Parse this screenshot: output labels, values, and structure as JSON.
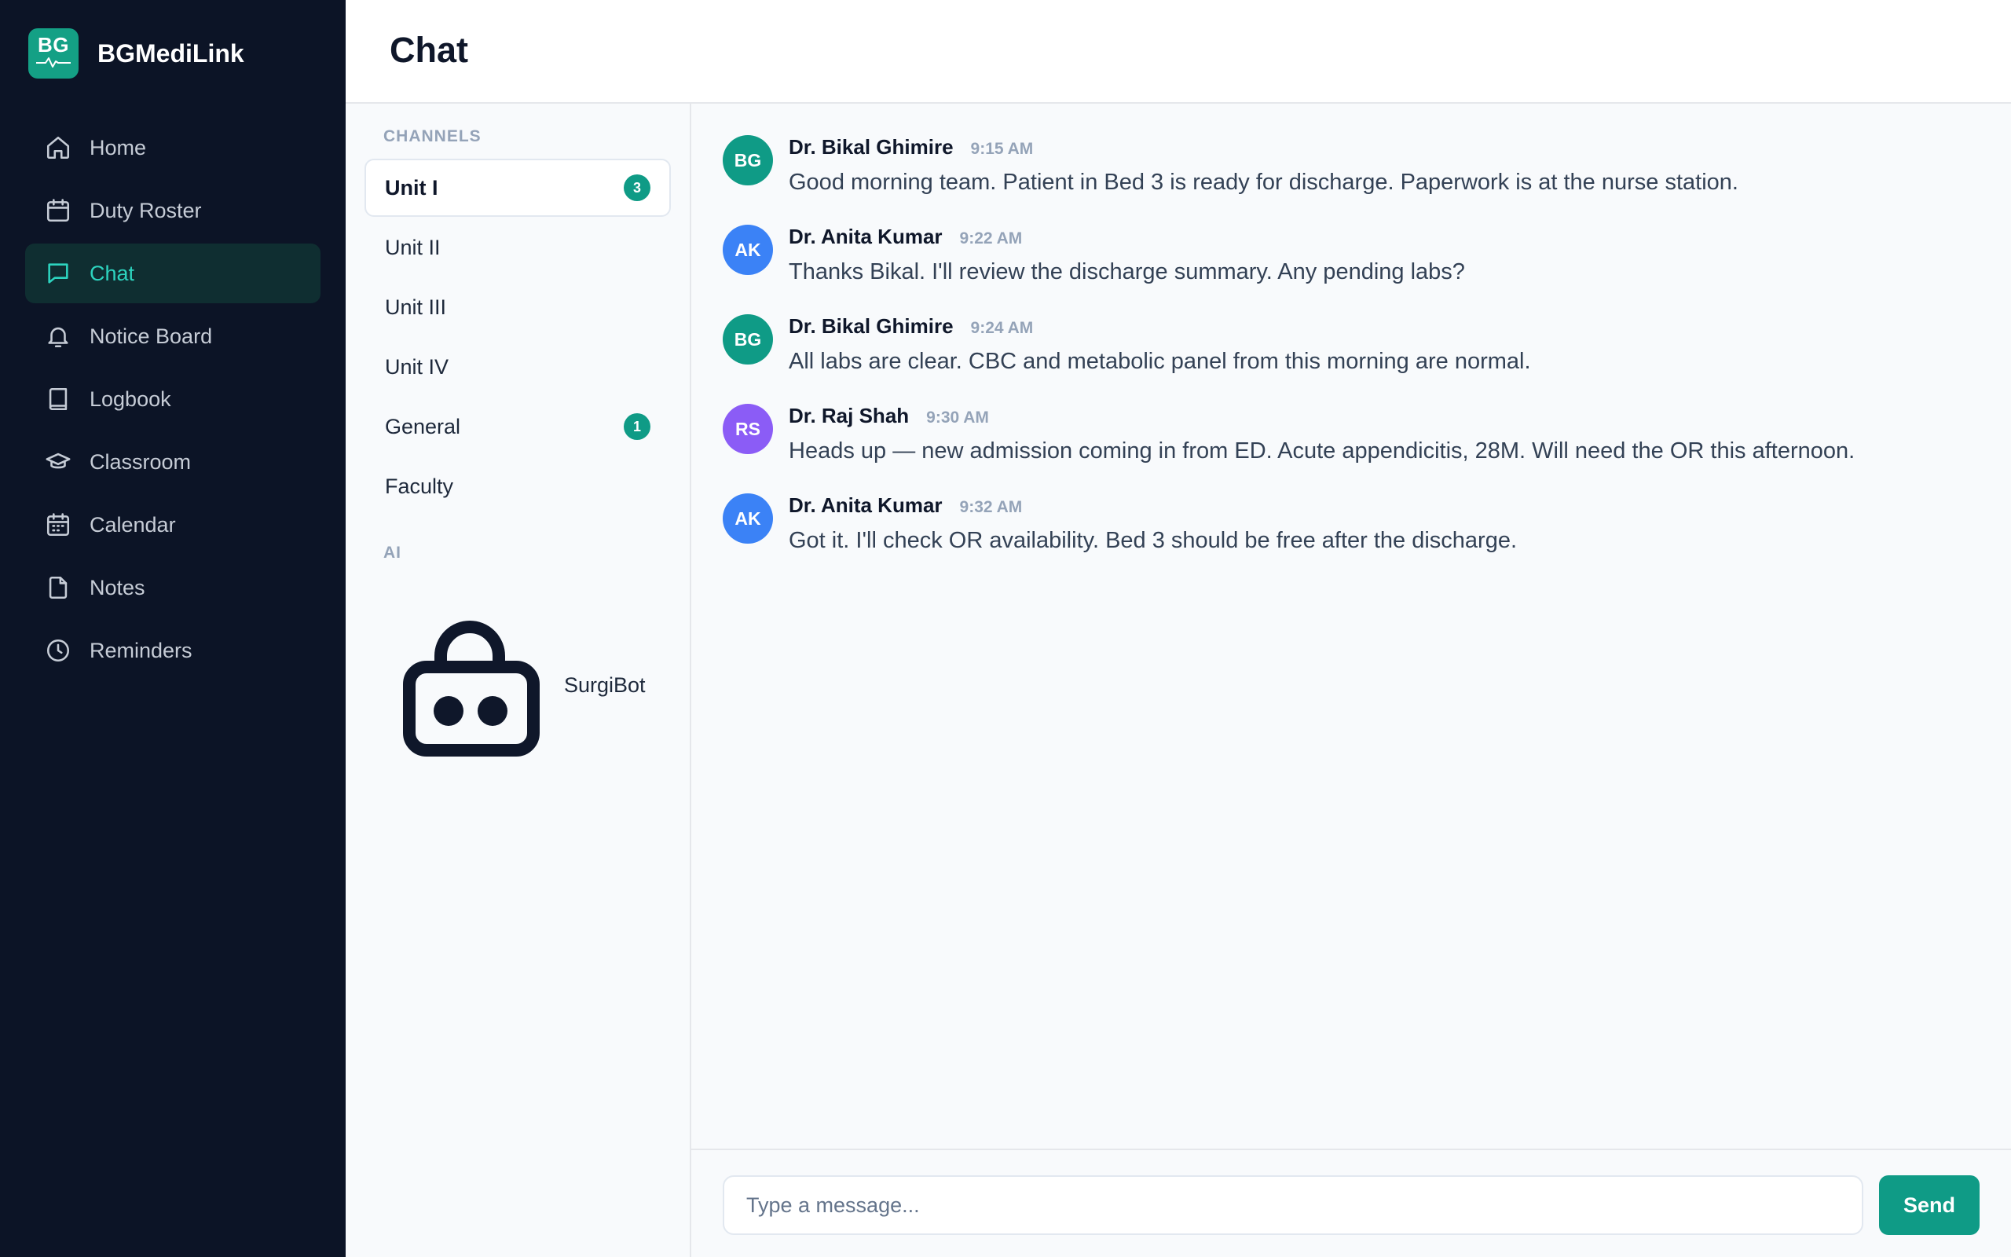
{
  "app": {
    "name": "BGMediLink",
    "logo_text": "BG"
  },
  "sidebar": {
    "items": [
      {
        "label": "Home",
        "icon": "home-icon",
        "active": false
      },
      {
        "label": "Duty Roster",
        "icon": "calendar-icon",
        "active": false
      },
      {
        "label": "Chat",
        "icon": "chat-icon",
        "active": true
      },
      {
        "label": "Notice Board",
        "icon": "bell-icon",
        "active": false
      },
      {
        "label": "Logbook",
        "icon": "book-icon",
        "active": false
      },
      {
        "label": "Classroom",
        "icon": "graduation-cap-icon",
        "active": false
      },
      {
        "label": "Calendar",
        "icon": "calendar-grid-icon",
        "active": false
      },
      {
        "label": "Notes",
        "icon": "file-icon",
        "active": false
      },
      {
        "label": "Reminders",
        "icon": "clock-icon",
        "active": false
      }
    ]
  },
  "header": {
    "title": "Chat"
  },
  "channels": {
    "section_label": "CHANNELS",
    "items": [
      {
        "name": "Unit I",
        "badge": "3",
        "active": true
      },
      {
        "name": "Unit II",
        "badge": "",
        "active": false
      },
      {
        "name": "Unit III",
        "badge": "",
        "active": false
      },
      {
        "name": "Unit IV",
        "badge": "",
        "active": false
      },
      {
        "name": "General",
        "badge": "1",
        "active": false
      },
      {
        "name": "Faculty",
        "badge": "",
        "active": false
      }
    ],
    "ai_label": "AI",
    "ai_items": [
      {
        "name": "SurgiBot",
        "icon": "robot-icon"
      }
    ]
  },
  "messages": [
    {
      "initials": "BG",
      "color": "#0f9b86",
      "sender": "Dr. Bikal Ghimire",
      "time": "9:15 AM",
      "text": "Good morning team. Patient in Bed 3 is ready for discharge. Paperwork is at the nurse station."
    },
    {
      "initials": "AK",
      "color": "#3b82f6",
      "sender": "Dr. Anita Kumar",
      "time": "9:22 AM",
      "text": "Thanks Bikal. I'll review the discharge summary. Any pending labs?"
    },
    {
      "initials": "BG",
      "color": "#0f9b86",
      "sender": "Dr. Bikal Ghimire",
      "time": "9:24 AM",
      "text": "All labs are clear. CBC and metabolic panel from this morning are normal."
    },
    {
      "initials": "RS",
      "color": "#8b5cf6",
      "sender": "Dr. Raj Shah",
      "time": "9:30 AM",
      "text": "Heads up — new admission coming in from ED. Acute appendicitis, 28M. Will need the OR this afternoon."
    },
    {
      "initials": "AK",
      "color": "#3b82f6",
      "sender": "Dr. Anita Kumar",
      "time": "9:32 AM",
      "text": "Got it. I'll check OR availability. Bed 3 should be free after the discharge."
    }
  ],
  "composer": {
    "placeholder": "Type a message...",
    "send_label": "Send"
  },
  "colors": {
    "sidebar_bg": "#0c1426",
    "accent": "#0f9b86",
    "active_nav_text": "#2dd4bf"
  }
}
